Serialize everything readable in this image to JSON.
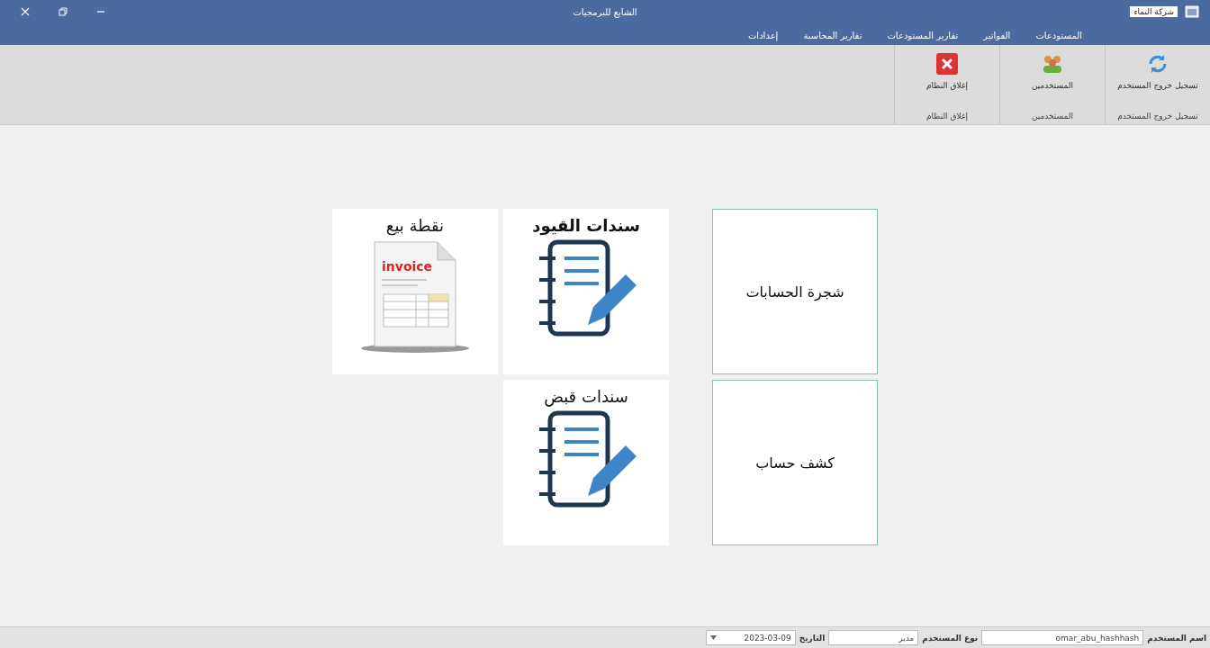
{
  "window": {
    "title": "الشايع للبرمجيات",
    "company": "شركة النماء"
  },
  "menu": [
    {
      "label": "المستودعات",
      "selected": false
    },
    {
      "label": "الفواتير",
      "selected": false
    },
    {
      "label": "تقارير المستودعات",
      "selected": false
    },
    {
      "label": "تقارير المحاسبة",
      "selected": false
    },
    {
      "label": "إعدادات",
      "selected": false
    }
  ],
  "ribbon": [
    {
      "kind": "logout",
      "label": "تسجيل خروج المستخدم",
      "group": "تسجيل خروج المستخدم"
    },
    {
      "kind": "users",
      "label": "المستخدمين",
      "group": "المستخدمين"
    },
    {
      "kind": "close",
      "label": "إغلاق النظام",
      "group": "إغلاق النظام"
    }
  ],
  "tiles": [
    {
      "kind": "text",
      "label": "شجرة الحسابات",
      "bold": false
    },
    {
      "kind": "notebook",
      "label": "سندات القيود",
      "bold": true
    },
    {
      "kind": "invoice",
      "label": "نقطة بيع",
      "bold": false,
      "art_text": "invoice"
    },
    {
      "kind": "text",
      "label": "كشف حساب",
      "bold": false
    },
    {
      "kind": "notebook",
      "label": "سندات قبض",
      "bold": false
    }
  ],
  "status_bar": [
    {
      "label": "اسم المستخدم",
      "value": "omar_abu_hashhash"
    },
    {
      "label": "نوع المستخدم",
      "value": "مدير"
    },
    {
      "label": "التاريخ",
      "value": "2023-03-09",
      "kind": "date"
    }
  ]
}
